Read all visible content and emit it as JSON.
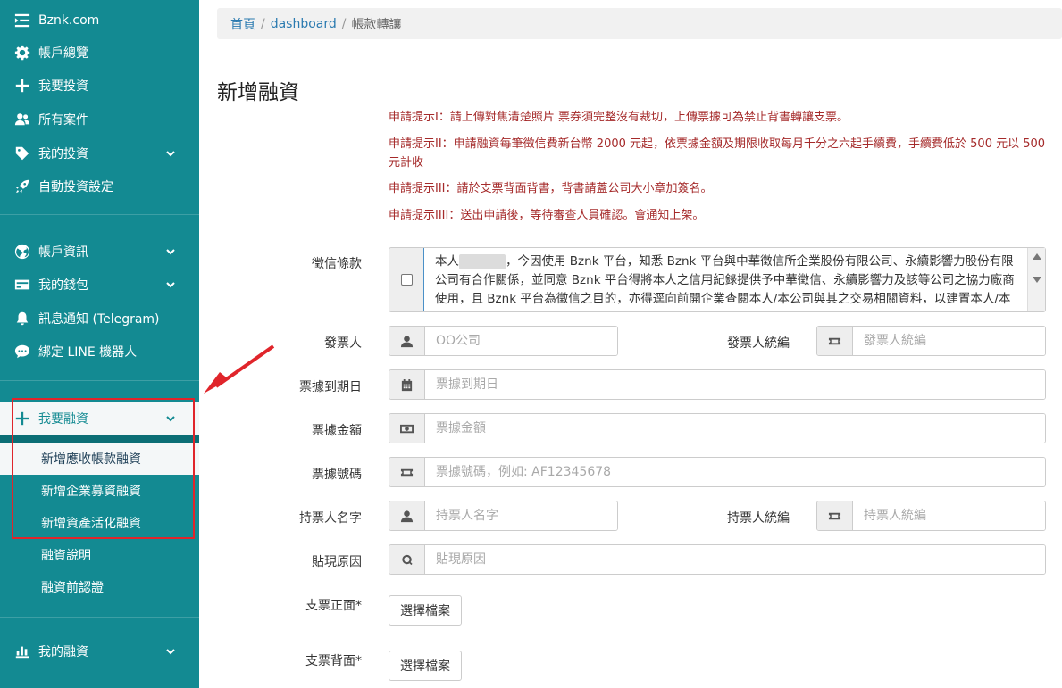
{
  "sidebar": {
    "brand": "Bznk.com",
    "top_items": [
      {
        "label": "帳戶總覽",
        "icon": "gear-icon"
      },
      {
        "label": "我要投資",
        "icon": "plus-icon"
      },
      {
        "label": "所有案件",
        "icon": "users-icon"
      },
      {
        "label": "我的投資",
        "icon": "tag-icon"
      },
      {
        "label": "自動投資設定",
        "icon": "rocket-icon"
      }
    ],
    "account_items": [
      {
        "label": "帳戶資訊",
        "icon": "globe-icon"
      },
      {
        "label": "我的錢包",
        "icon": "card-icon"
      },
      {
        "label": "訊息通知 (Telegram)",
        "icon": "bell-icon"
      },
      {
        "label": "綁定 LINE 機器人",
        "icon": "chat-icon"
      }
    ],
    "financing": {
      "label": "我要融資",
      "subitems": [
        "新增應收帳款融資",
        "新增企業募資融資",
        "新增資產活化融資",
        "融資說明",
        "融資前認證"
      ]
    },
    "my_financing": "我的融資"
  },
  "breadcrumb": {
    "home": "首頁",
    "dashboard": "dashboard",
    "current": "帳款轉讓"
  },
  "page_title": "新增融資",
  "tips": [
    "申請提示I：請上傳對焦清楚照片 票券須完整沒有裁切，上傳票據可為禁止背書轉讓支票。",
    "申請提示II：申請融資每筆徵信費新台幣 2000 元起，依票據金額及期限收取每月千分之六起手續費，手續費低於 500 元以 500 元計收",
    "申請提示III：請於支票背面背書，背書請蓋公司大小章加簽名。",
    "申請提示IIII：送出申請後，等待審查人員確認。會通知上架。"
  ],
  "form": {
    "consent_label": "徵信條款",
    "consent_text_pre": "本人",
    "consent_text": "，今因使用 Bznk 平台，知悉 Bznk 平台與中華徵信所企業股份有限公司、永續影響力股份有限公司有合作關係，並同意 Bznk 平台得將本人之信用紀錄提供予中華徵信、永續影響力及該等公司之協力廠商使用，且 Bznk 平台為徵信之目的，亦得逕向前開企業查閱本人/本公司與其之交易相關資料，以建置本人/本公司之徵信報告。",
    "issuer_label": "發票人",
    "issuer_placeholder": "OO公司",
    "issuer_id_label": "發票人統編",
    "issuer_id_placeholder": "發票人統編",
    "due_label": "票據到期日",
    "due_placeholder": "票據到期日",
    "amount_label": "票據金額",
    "amount_placeholder": "票據金額",
    "number_label": "票據號碼",
    "number_placeholder": "票據號碼，例如: AF12345678",
    "holder_label": "持票人名字",
    "holder_placeholder": "持票人名字",
    "holder_id_label": "持票人統編",
    "holder_id_placeholder": "持票人統編",
    "reason_label": "貼現原因",
    "reason_placeholder": "貼現原因",
    "front_label": "支票正面*",
    "back_label": "支票背面*",
    "file_button": "選擇檔案"
  },
  "colors": {
    "sidebar": "#138a92",
    "highlight_box": "#e0252b",
    "tip_text": "#a52a2a",
    "link": "#2a7ab0"
  }
}
